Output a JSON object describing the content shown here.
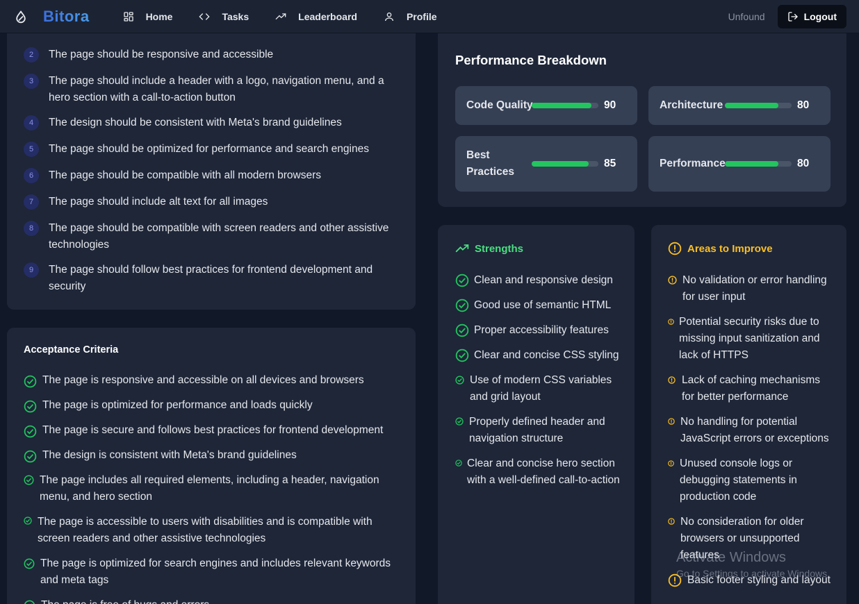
{
  "app": {
    "name": "Bitora"
  },
  "nav": {
    "items": [
      {
        "label": "Home",
        "icon": "grid-icon"
      },
      {
        "label": "Tasks",
        "icon": "code-icon"
      },
      {
        "label": "Leaderboard",
        "icon": "trending-up-icon"
      },
      {
        "label": "Profile",
        "icon": "user-icon"
      }
    ],
    "username": "Unfound",
    "logout_label": "Logout"
  },
  "requirements": {
    "items": [
      {
        "num": "2",
        "text": "The page should be responsive and accessible"
      },
      {
        "num": "3",
        "text": "The page should include a header with a logo, navigation menu, and a hero section with a call-to-action button"
      },
      {
        "num": "4",
        "text": "The design should be consistent with Meta's brand guidelines"
      },
      {
        "num": "5",
        "text": "The page should be optimized for performance and search engines"
      },
      {
        "num": "6",
        "text": "The page should be compatible with all modern browsers"
      },
      {
        "num": "7",
        "text": "The page should include alt text for all images"
      },
      {
        "num": "8",
        "text": "The page should be compatible with screen readers and other assistive technologies"
      },
      {
        "num": "9",
        "text": "The page should follow best practices for frontend development and security"
      }
    ]
  },
  "acceptance": {
    "title": "Acceptance Criteria",
    "items": [
      "The page is responsive and accessible on all devices and browsers",
      "The page is optimized for performance and loads quickly",
      "The page is secure and follows best practices for frontend development",
      "The design is consistent with Meta's brand guidelines",
      "The page includes all required elements, including a header, navigation menu, and hero section",
      "The page is accessible to users with disabilities and is compatible with screen readers and other assistive technologies",
      "The page is optimized for search engines and includes relevant keywords and meta tags",
      "The page is free of bugs and errors"
    ]
  },
  "performance": {
    "title": "Performance Breakdown",
    "metrics": [
      {
        "label": "Code Quality",
        "value": 90
      },
      {
        "label": "Architecture",
        "value": 80
      },
      {
        "label": "Best Practices",
        "value": 85
      },
      {
        "label": "Performance",
        "value": 80
      }
    ]
  },
  "strengths": {
    "title": "Strengths",
    "color": "#4ade80",
    "items": [
      "Clean and responsive design",
      "Good use of semantic HTML",
      "Proper accessibility features",
      "Clear and concise CSS styling",
      "Use of modern CSS variables and grid layout",
      "Properly defined header and navigation structure",
      "Clear and concise hero section with a well-defined call-to-action"
    ]
  },
  "improvements": {
    "title": "Areas to Improve",
    "color": "#fbbf24",
    "items": [
      "No validation or error handling for user input",
      "Potential security risks due to missing input sanitization and lack of HTTPS",
      "Lack of caching mechanisms for better performance",
      "No handling for potential JavaScript errors or exceptions",
      "Unused console logs or debugging statements in production code",
      "No consideration for older browsers or unsupported features",
      "Basic footer styling and layout"
    ]
  },
  "watermark": {
    "line1": "Activate Windows",
    "line2": "Go to Settings to activate Windows."
  }
}
